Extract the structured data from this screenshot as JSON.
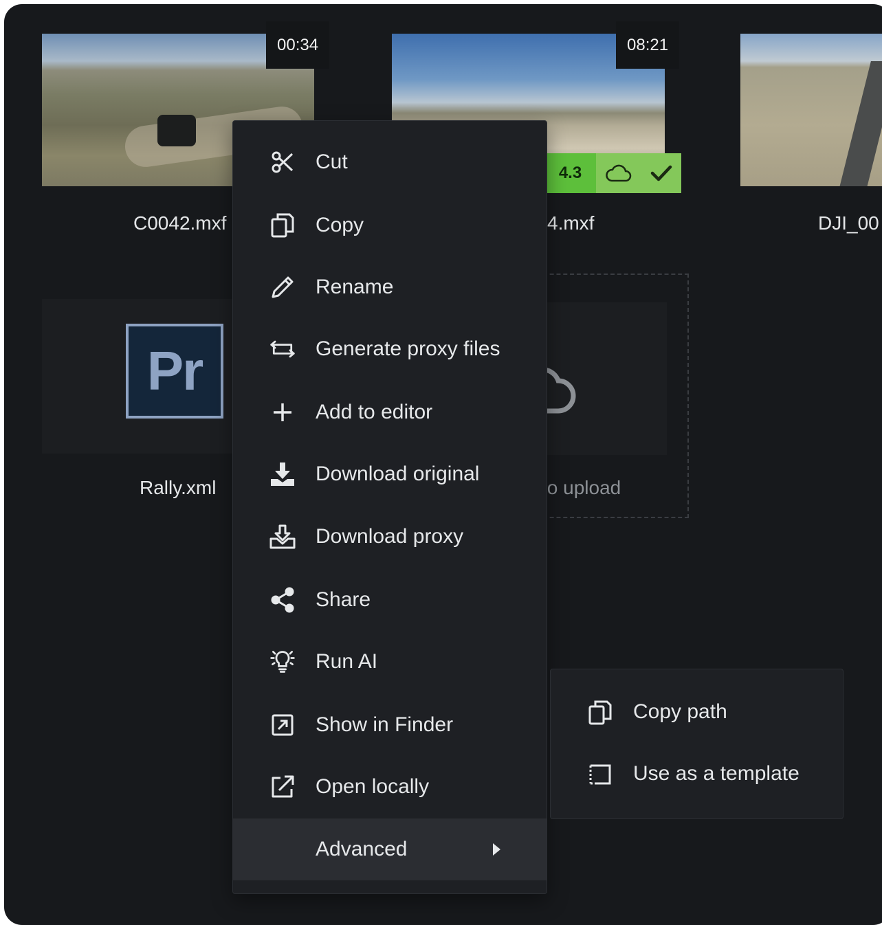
{
  "thumbnails": [
    {
      "filename": "C0042.mxf",
      "duration": "00:34"
    },
    {
      "filename": "4.mxf",
      "duration": "08:21",
      "score": "4.3"
    },
    {
      "filename": "DJI_00"
    }
  ],
  "project_file": {
    "filename": "Rally.xml",
    "logo_text": "Pr"
  },
  "upload": {
    "text": "to upload"
  },
  "context_menu": {
    "items": [
      {
        "label": "Cut",
        "icon": "scissors-icon"
      },
      {
        "label": "Copy",
        "icon": "copy-icon"
      },
      {
        "label": "Rename",
        "icon": "pencil-icon"
      },
      {
        "label": "Generate proxy files",
        "icon": "proxy-icon"
      },
      {
        "label": "Add to editor",
        "icon": "plus-icon"
      },
      {
        "label": "Download original",
        "icon": "download-icon"
      },
      {
        "label": "Download proxy",
        "icon": "download-proxy-icon"
      },
      {
        "label": "Share",
        "icon": "share-icon"
      },
      {
        "label": "Run AI",
        "icon": "lightbulb-icon"
      },
      {
        "label": "Show in Finder",
        "icon": "reveal-icon"
      },
      {
        "label": "Open locally",
        "icon": "external-link-icon"
      }
    ],
    "advanced_label": "Advanced"
  },
  "submenu": {
    "items": [
      {
        "label": "Copy path",
        "icon": "copy-icon"
      },
      {
        "label": "Use as a template",
        "icon": "template-icon"
      }
    ]
  },
  "colors": {
    "accent_green": "#5dbf3b",
    "panel": "#17191c",
    "menu": "#1e2024"
  }
}
